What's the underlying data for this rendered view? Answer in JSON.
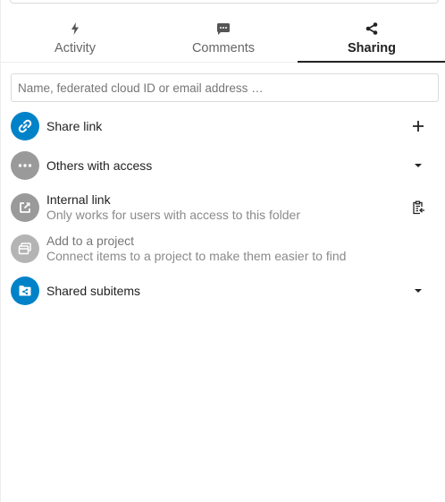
{
  "tabs": [
    {
      "label": "Activity",
      "icon": "activity-icon",
      "active": false
    },
    {
      "label": "Comments",
      "icon": "comment-icon",
      "active": false
    },
    {
      "label": "Sharing",
      "icon": "share-icon",
      "active": true
    }
  ],
  "search": {
    "placeholder": "Name, federated cloud ID or email address …",
    "value": ""
  },
  "entries": {
    "share_link": {
      "title": "Share link",
      "icon": "link-icon",
      "action_icon": "add-icon"
    },
    "others_with_access": {
      "title": "Others with access",
      "icon": "more-horizontal-icon",
      "action_icon": "chevron-down-icon"
    },
    "internal_link": {
      "title": "Internal link",
      "subtitle": "Only works for users with access to this folder",
      "icon": "external-link-icon",
      "action_icon": "clipboard-icon"
    },
    "project": {
      "title": "Add to a project",
      "subtitle": "Connect items to a project to make them easier to find",
      "icon": "project-icon"
    },
    "shared_subitems": {
      "title": "Shared subitems",
      "icon": "shared-folder-icon",
      "action_icon": "chevron-down-icon"
    }
  },
  "colors": {
    "primary": "#0082c9",
    "avatar_grey": "#9a9a9a",
    "text_muted": "#8a8a8a"
  }
}
